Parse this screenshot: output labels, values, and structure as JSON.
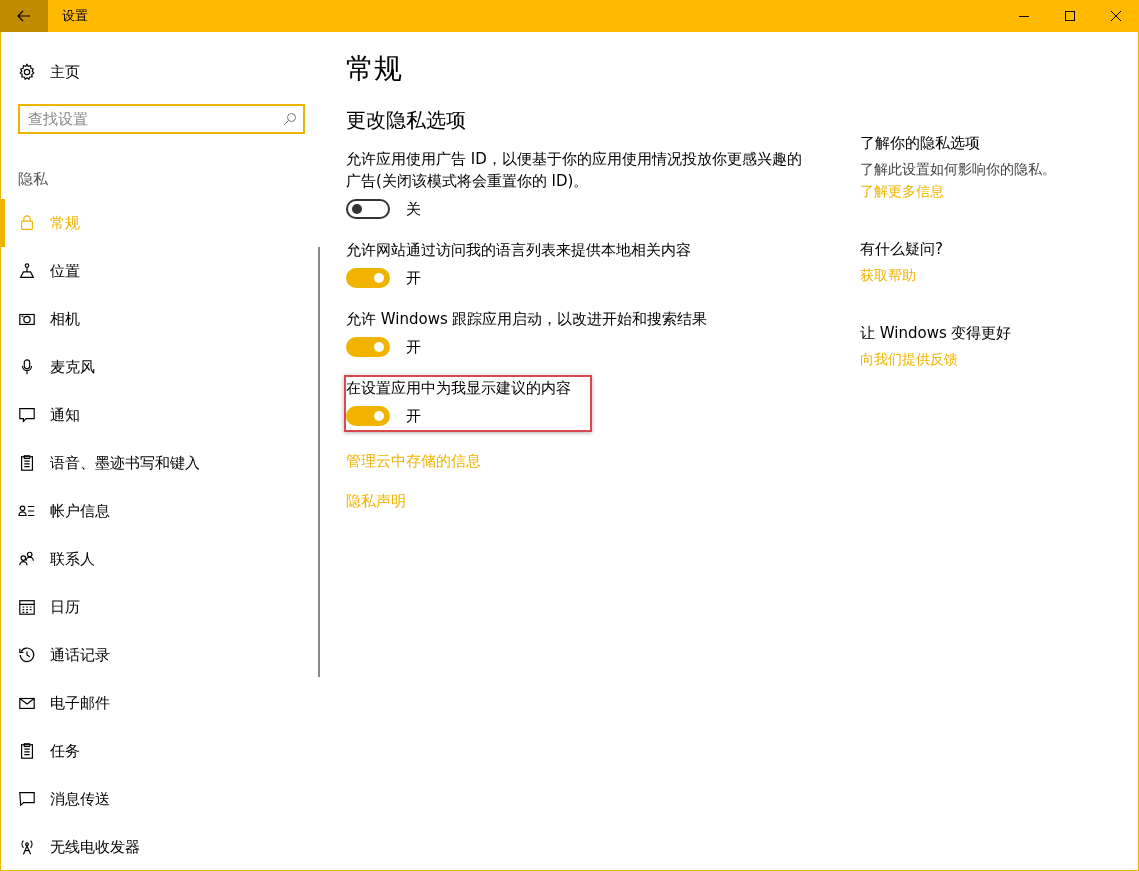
{
  "window": {
    "title": "设置"
  },
  "sidebar": {
    "home": "主页",
    "search": {
      "placeholder": "查找设置"
    },
    "section": "隐私",
    "items": [
      {
        "label": "常规",
        "selected": true
      },
      {
        "label": "位置",
        "selected": false
      },
      {
        "label": "相机",
        "selected": false
      },
      {
        "label": "麦克风",
        "selected": false
      },
      {
        "label": "通知",
        "selected": false
      },
      {
        "label": "语音、墨迹书写和键入",
        "selected": false
      },
      {
        "label": "帐户信息",
        "selected": false
      },
      {
        "label": "联系人",
        "selected": false
      },
      {
        "label": "日历",
        "selected": false
      },
      {
        "label": "通话记录",
        "selected": false
      },
      {
        "label": "电子邮件",
        "selected": false
      },
      {
        "label": "任务",
        "selected": false
      },
      {
        "label": "消息传送",
        "selected": false
      },
      {
        "label": "无线电收发器",
        "selected": false
      }
    ]
  },
  "content": {
    "title": "常规",
    "subtitle": "更改隐私选项",
    "settings": [
      {
        "description": "允许应用使用广告 ID，以便基于你的应用使用情况投放你更感兴趣的广告(关闭该模式将会重置你的 ID)。",
        "on": false,
        "state_label": "关",
        "highlighted": false
      },
      {
        "description": "允许网站通过访问我的语言列表来提供本地相关内容",
        "on": true,
        "state_label": "开",
        "highlighted": false
      },
      {
        "description": "允许 Windows 跟踪应用启动，以改进开始和搜索结果",
        "on": true,
        "state_label": "开",
        "highlighted": false
      },
      {
        "description": "在设置应用中为我显示建议的内容",
        "on": true,
        "state_label": "开",
        "highlighted": true
      }
    ],
    "links": [
      "管理云中存储的信息",
      "隐私声明"
    ]
  },
  "related": [
    {
      "heading": "了解你的隐私选项",
      "text": "了解此设置如何影响你的隐私。",
      "link": "了解更多信息"
    },
    {
      "heading": "有什么疑问?",
      "link": "获取帮助"
    },
    {
      "heading": "让 Windows 变得更好",
      "link": "向我们提供反馈"
    }
  ]
}
